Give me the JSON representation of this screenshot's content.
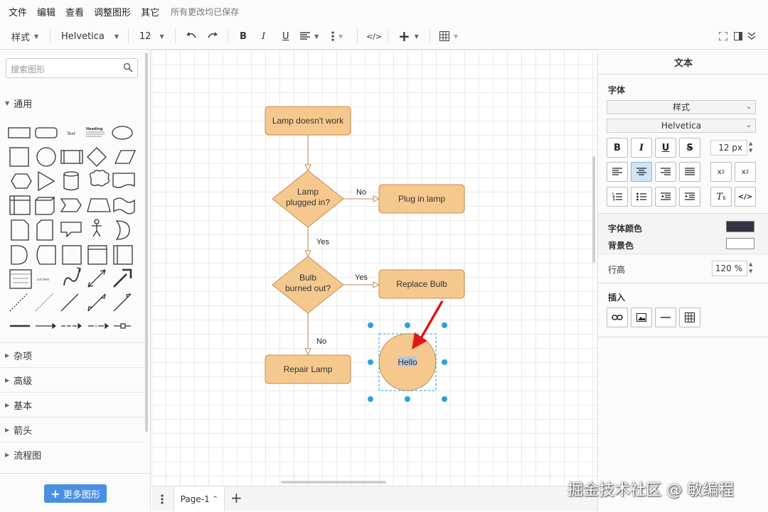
{
  "menu": {
    "items": [
      "文件",
      "编辑",
      "查看",
      "调整图形",
      "其它"
    ],
    "status": "所有更改均已保存"
  },
  "toolbar": {
    "style_label": "样式",
    "font": "Helvetica",
    "font_size": "12"
  },
  "left": {
    "search_placeholder": "搜索图形",
    "general": "通用",
    "shape_texts": {
      "text": "Text",
      "heading": "Heading",
      "list": "List Item"
    },
    "sections": [
      "杂项",
      "高级",
      "基本",
      "箭头",
      "流程图"
    ],
    "more_shapes": "更多图形"
  },
  "diagram": {
    "fill": "#f5c98e",
    "stroke": "#c98a50",
    "nodes": {
      "start": "Lamp doesn't work",
      "d1_line1": "Lamp",
      "d1_line2": "plugged in?",
      "plug": "Plug in lamp",
      "d2_line1": "Bulb",
      "d2_line2": "burned out?",
      "replace": "Replace Bulb",
      "repair": "Repair Lamp",
      "circle": "Hello"
    },
    "edges": {
      "no1": "No",
      "yes1": "Yes",
      "yes2": "Yes",
      "no2": "No"
    }
  },
  "bottom": {
    "page_tab": "Page-1"
  },
  "right": {
    "title": "文本",
    "font_section": "字体",
    "style_select": "样式",
    "font_select": "Helvetica",
    "size": "12 px",
    "font_color_label": "字体颜色",
    "font_color": "#333344",
    "bg_color_label": "背景色",
    "line_height_label": "行高",
    "line_height": "120 %",
    "insert_label": "插入"
  },
  "watermark": "掘金技术社区 @ 敏编程"
}
